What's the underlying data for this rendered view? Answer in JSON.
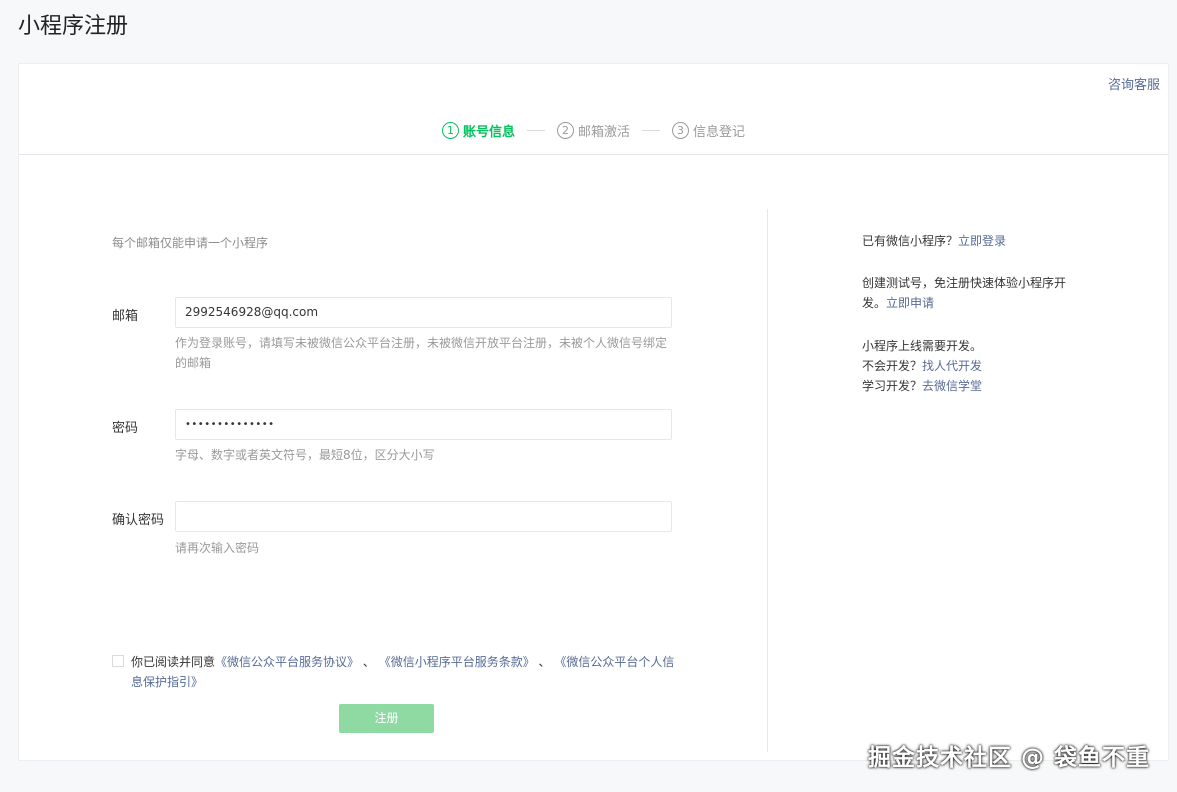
{
  "page": {
    "title": "小程序注册"
  },
  "header": {
    "consult": "咨询客服"
  },
  "steps": [
    {
      "num": "1",
      "label": "账号信息",
      "active": true
    },
    {
      "num": "2",
      "label": "邮箱激活",
      "active": false
    },
    {
      "num": "3",
      "label": "信息登记",
      "active": false
    }
  ],
  "form": {
    "notice": "每个邮箱仅能申请一个小程序",
    "email": {
      "label": "邮箱",
      "value": "2992546928@qq.com",
      "hint": "作为登录账号，请填写未被微信公众平台注册，未被微信开放平台注册，未被个人微信号绑定的邮箱"
    },
    "password": {
      "label": "密码",
      "value": "••••••••••••••",
      "hint": "字母、数字或者英文符号，最短8位，区分大小写"
    },
    "confirm": {
      "label": "确认密码",
      "value": "",
      "hint": "请再次输入密码"
    },
    "agree": {
      "prefix": "你已阅读并同意",
      "link1": "《微信公众平台服务协议》",
      "sep1": "、",
      "link2": "《微信小程序平台服务条款》",
      "sep2": "、",
      "link3": "《微信公众平台个人信息保护指引》"
    },
    "submit": "注册"
  },
  "side": {
    "has_program": "已有微信小程序？",
    "login_link": "立即登录",
    "test_text": "创建测试号，免注册快速体验小程序开发。",
    "apply_link": "立即申请",
    "dev_text": "小程序上线需要开发。",
    "no_dev": "不会开发？",
    "find_link": "找人代开发",
    "learn": "学习开发？",
    "school_link": "去微信学堂"
  },
  "watermark": "掘金技术社区 @ 袋鱼不重",
  "colors": {
    "accent": "#07c160",
    "link": "#576b95",
    "submit_disabled": "#8fd9a3"
  }
}
